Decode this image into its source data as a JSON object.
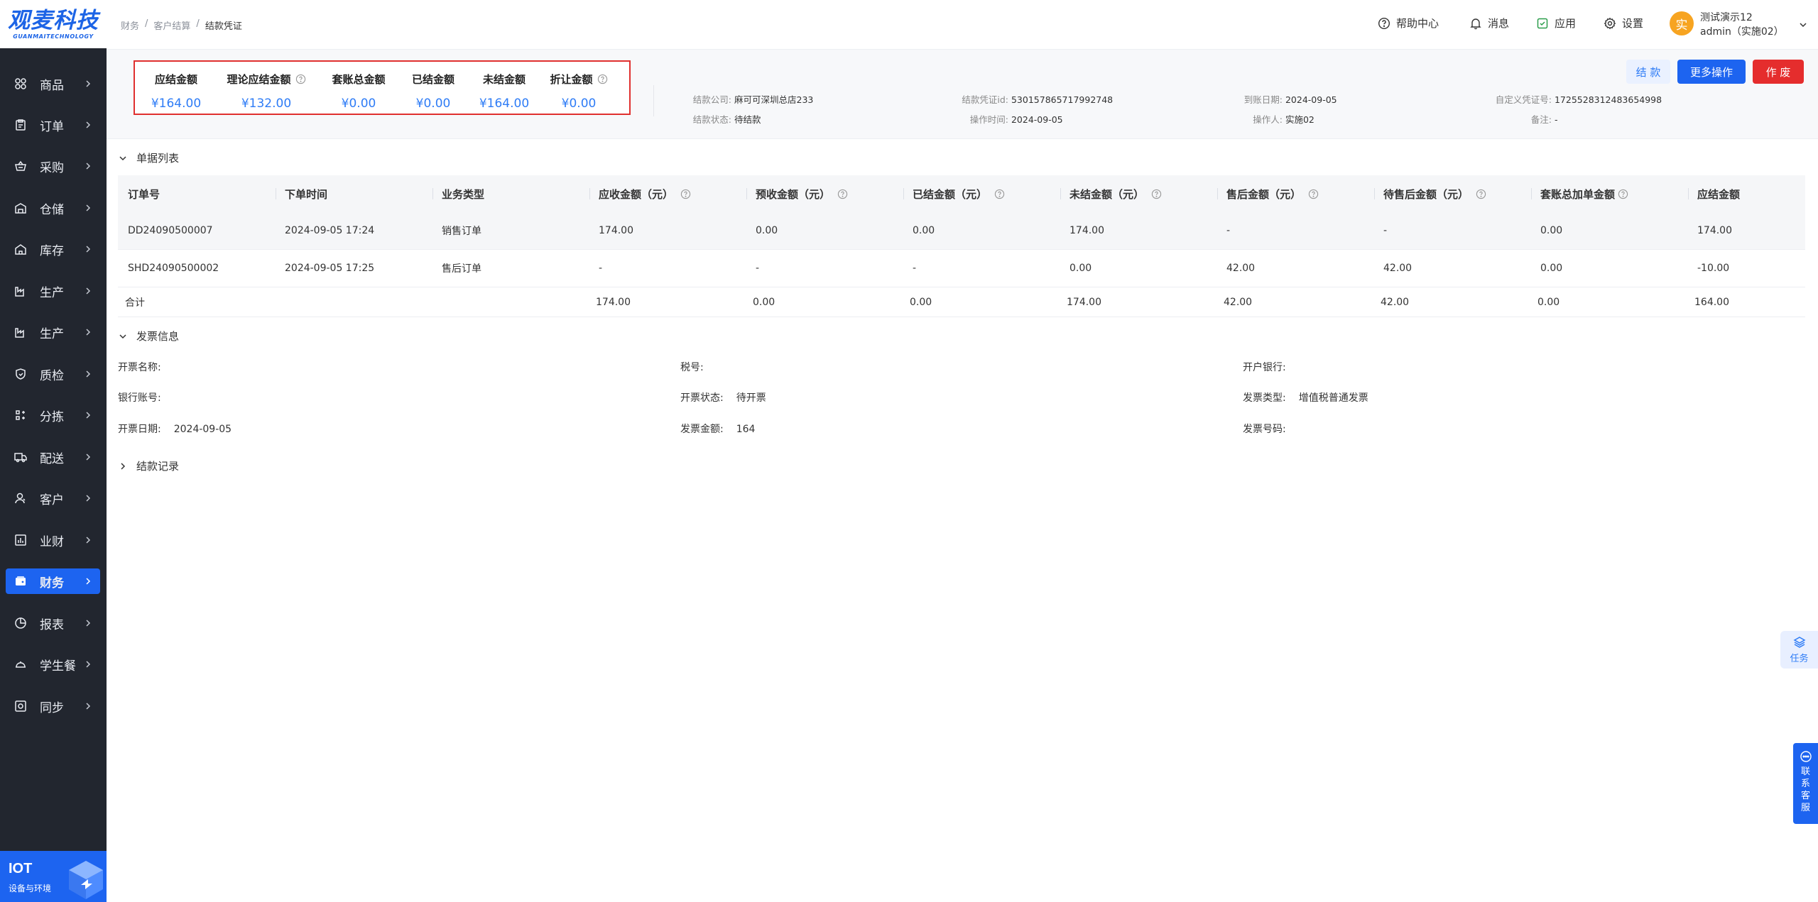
{
  "logo": {
    "main": "观麦科技",
    "sub": "GUANMAITECHNOLOGY"
  },
  "sidebar": {
    "items": [
      {
        "label": "商品",
        "icon": "grid-icon",
        "active": false
      },
      {
        "label": "订单",
        "icon": "clipboard-icon",
        "active": false
      },
      {
        "label": "采购",
        "icon": "basket-icon",
        "active": false
      },
      {
        "label": "仓储",
        "icon": "warehouse-icon",
        "active": false
      },
      {
        "label": "库存",
        "icon": "stock-icon",
        "active": false
      },
      {
        "label": "生产",
        "icon": "factory-icon",
        "active": false
      },
      {
        "label": "生产",
        "icon": "factory-icon",
        "active": false
      },
      {
        "label": "质检",
        "icon": "shield-icon",
        "active": false
      },
      {
        "label": "分拣",
        "icon": "sort-icon",
        "active": false
      },
      {
        "label": "配送",
        "icon": "truck-icon",
        "active": false
      },
      {
        "label": "客户",
        "icon": "user-icon",
        "active": false
      },
      {
        "label": "业财",
        "icon": "bar-chart-icon",
        "active": false
      },
      {
        "label": "财务",
        "icon": "wallet-icon",
        "active": true
      },
      {
        "label": "报表",
        "icon": "pie-chart-icon",
        "active": false
      },
      {
        "label": "学生餐",
        "icon": "dish-icon",
        "active": false
      },
      {
        "label": "同步",
        "icon": "sync-icon",
        "active": false
      }
    ],
    "iot": {
      "title": "IOT",
      "subtitle": "设备与环境"
    }
  },
  "header": {
    "breadcrumb": [
      "财务",
      "客户结算",
      "结款凭证"
    ],
    "help": "帮助中心",
    "messages": "消息",
    "apps": "应用",
    "settings": "设置",
    "user": {
      "avatar": "实",
      "name": "测试演示12",
      "role": "admin（实施02）"
    }
  },
  "summary": {
    "metrics": [
      {
        "label": "应结金额",
        "value": "¥164.00",
        "help": false
      },
      {
        "label": "理论应结金额",
        "value": "¥132.00",
        "help": true
      },
      {
        "label": "套账总金额",
        "value": "¥0.00",
        "help": false
      },
      {
        "label": "已结金额",
        "value": "¥0.00",
        "help": false
      },
      {
        "label": "未结金额",
        "value": "¥164.00",
        "help": false
      },
      {
        "label": "折让金额",
        "value": "¥0.00",
        "help": true
      }
    ],
    "info": {
      "company_label": "结款公司:",
      "company": "麻可可深圳总店233",
      "status_label": "结款状态:",
      "status": "待结款",
      "voucher_id_label": "结款凭证id:",
      "voucher_id": "530157865717992748",
      "op_time_label": "操作时间:",
      "op_time": "2024-09-05",
      "arrival_label": "到账日期:",
      "arrival": "2024-09-05",
      "operator_label": "操作人:",
      "operator": "实施02",
      "custom_no_label": "自定义凭证号:",
      "custom_no": "1725528312483654998",
      "remark_label": "备注:",
      "remark": "-"
    },
    "buttons": {
      "settle": "结 款",
      "more": "更多操作",
      "void": "作 废"
    }
  },
  "doc_list": {
    "title": "单据列表",
    "columns": [
      "订单号",
      "下单时间",
      "业务类型",
      "应收金额（元）",
      "预收金额（元）",
      "已结金额（元）",
      "未结金额（元）",
      "售后金额（元）",
      "待售后金额（元）",
      "套账总加单金额",
      "应结金额"
    ],
    "rows": [
      [
        "DD24090500007",
        "2024-09-05 17:24",
        "销售订单",
        "174.00",
        "0.00",
        "0.00",
        "174.00",
        "-",
        "-",
        "0.00",
        "174.00"
      ],
      [
        "SHD24090500002",
        "2024-09-05 17:25",
        "售后订单",
        "-",
        "-",
        "-",
        "0.00",
        "42.00",
        "42.00",
        "0.00",
        "-10.00"
      ]
    ],
    "total": [
      "合计",
      "",
      "",
      "174.00",
      "0.00",
      "0.00",
      "174.00",
      "42.00",
      "42.00",
      "0.00",
      "164.00"
    ]
  },
  "invoice": {
    "title": "发票信息",
    "name_label": "开票名称:",
    "name": "",
    "tax_label": "税号:",
    "tax": "",
    "bank_label": "开户银行:",
    "bank": "",
    "account_label": "银行账号:",
    "account": "",
    "state_label": "开票状态:",
    "state": "待开票",
    "type_label": "发票类型:",
    "type": "增值税普通发票",
    "date_label": "开票日期:",
    "date": "2024-09-05",
    "amount_label": "发票金额:",
    "amount": "164",
    "number_label": "发票号码:",
    "number": ""
  },
  "settle_records": {
    "title": "结款记录"
  },
  "floating": {
    "task": "任务",
    "service": [
      "联",
      "系",
      "客",
      "服"
    ]
  }
}
